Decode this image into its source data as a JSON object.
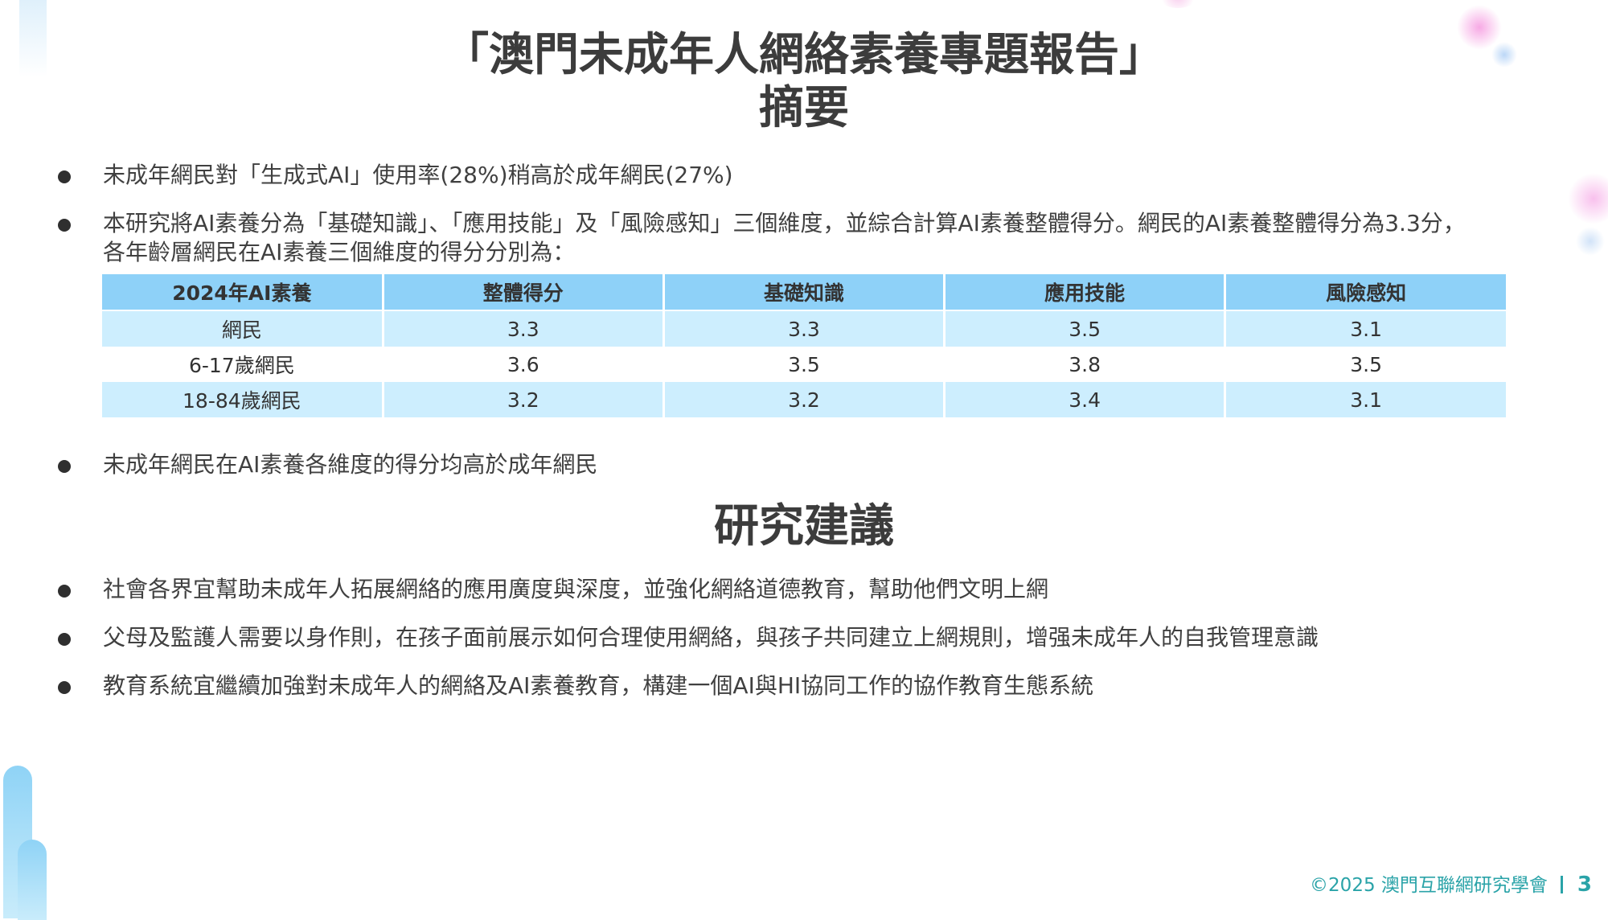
{
  "header": {
    "title": "「澳門未成年人網絡素養專題報告」",
    "subtitle": "摘要"
  },
  "summary": {
    "bullets": [
      "未成年網民對「生成式AI」使用率(28%)稍高於成年網民(27%)",
      "本研究將AI素養分為「基礎知識」、「應用技能」及「風險感知」三個維度，並綜合計算AI素養整體得分。網民的AI素養整體得分為3.3分，",
      "各年齡層網民在AI素養三個維度的得分分別為：",
      "未成年網民在AI素養各維度的得分均高於成年網民"
    ]
  },
  "table": {
    "headers": [
      "2024年AI素養",
      "整體得分",
      "基礎知識",
      "應用技能",
      "風險感知"
    ],
    "rows": [
      [
        "網民",
        "3.3",
        "3.3",
        "3.5",
        "3.1"
      ],
      [
        "6-17歲網民",
        "3.6",
        "3.5",
        "3.8",
        "3.5"
      ],
      [
        "18-84歲網民",
        "3.2",
        "3.2",
        "3.4",
        "3.1"
      ]
    ]
  },
  "recommendations": {
    "title": "研究建議",
    "bullets": [
      "社會各界宜幫助未成年人拓展網絡的應用廣度與深度，並強化網絡道德教育，幫助他們文明上網",
      "父母及監護人需要以身作則，在孩子面前展示如何合理使用網絡，與孩子共同建立上網規則，增强未成年人的自我管理意識",
      "教育系統宜繼續加強對未成年人的網絡及AI素養教育，構建一個AI與HI協同工作的協作教育生態系統"
    ]
  },
  "footer": {
    "copyright": "©2025 澳門互聯網研究學會",
    "page_number": "3"
  }
}
